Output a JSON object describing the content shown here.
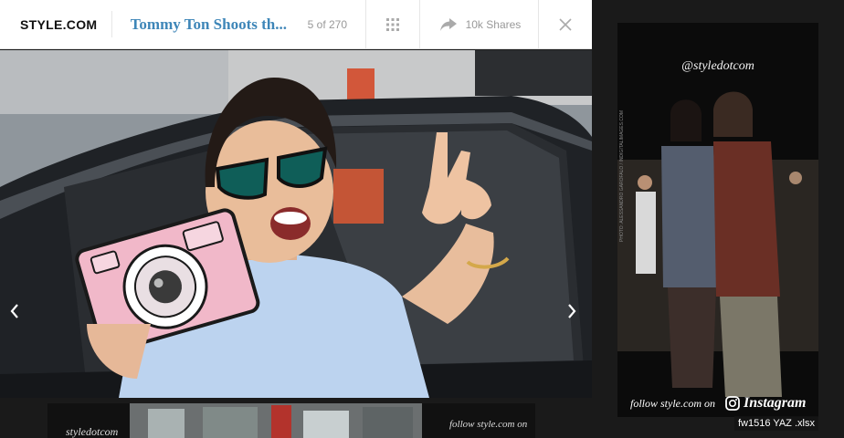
{
  "toolbar": {
    "logo": "STYLE.COM",
    "gallery_title": "Tommy Ton Shoots th...",
    "counter": "5 of 270",
    "share_label": "10k Shares"
  },
  "ad": {
    "handle": "@styledotcom",
    "credit": "PHOTO: ALESSANDRO GAROFALO / INDIGITALIMAGES.COM",
    "follow_text": "follow style.com on",
    "instagram_label": "Instagram"
  },
  "strip": {
    "handle": "styledotcom",
    "follow_text": "follow style.com on"
  },
  "file_label": "fw1516 YAZ .xlsx",
  "icons": {
    "grid": "grid-icon",
    "share": "share-arrow-icon",
    "close": "close-icon",
    "prev": "chevron-left-icon",
    "next": "chevron-right-icon",
    "instagram": "instagram-icon"
  },
  "colors": {
    "title_blue": "#3e86b8",
    "toolbar_bg": "#ffffff",
    "muted_text": "#999999"
  }
}
